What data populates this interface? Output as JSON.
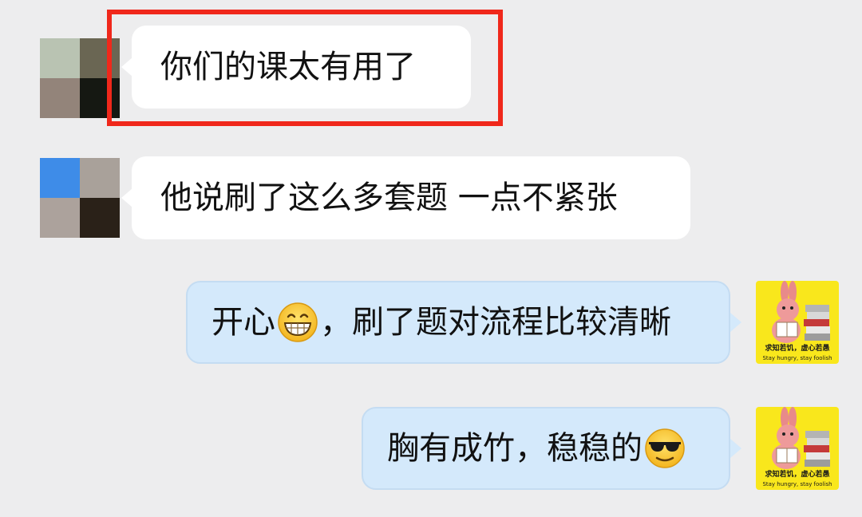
{
  "chat": {
    "messages": [
      {
        "sender": "other",
        "text": "你们的课太有用了"
      },
      {
        "sender": "other",
        "text": "他说刷了这么多套题 一点不紧张"
      },
      {
        "sender": "self",
        "text_before": "开心",
        "emoji": "grin-emoji",
        "text_after": "，刷了题对流程比较清晰"
      },
      {
        "sender": "self",
        "text_before": "胸有成竹，稳稳的",
        "emoji": "sunglasses-emoji",
        "text_after": ""
      }
    ]
  },
  "my_avatar": {
    "caption_cn": "求知若饥，虚心若愚",
    "caption_en": "Stay hungry, stay foolish",
    "bg_color": "#f9e71c",
    "icon": "rabbit-reading-books"
  },
  "colors": {
    "background": "#ededee",
    "incoming_bubble": "#ffffff",
    "outgoing_bubble": "#d4e9fb",
    "highlight": "#f0281b"
  }
}
